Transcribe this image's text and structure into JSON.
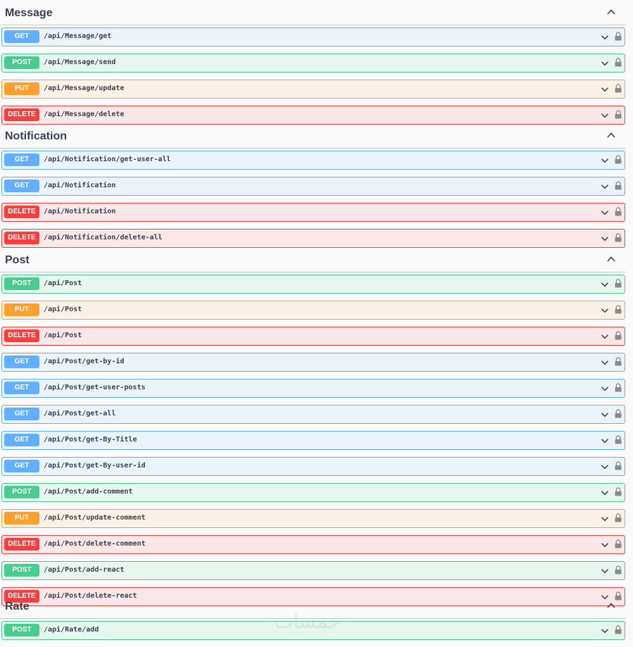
{
  "watermark": "خمسات",
  "sections": [
    {
      "title": "Message",
      "operations": [
        {
          "method": "GET",
          "kind": "get",
          "path": "/api/Message/get"
        },
        {
          "method": "POST",
          "kind": "post",
          "path": "/api/Message/send"
        },
        {
          "method": "PUT",
          "kind": "put",
          "path": "/api/Message/update"
        },
        {
          "method": "DELETE",
          "kind": "delete",
          "path": "/api/Message/delete"
        }
      ]
    },
    {
      "title": "Notification",
      "operations": [
        {
          "method": "GET",
          "kind": "get",
          "path": "/api/Notification/get-user-all"
        },
        {
          "method": "GET",
          "kind": "get",
          "path": "/api/Notification"
        },
        {
          "method": "DELETE",
          "kind": "delete",
          "path": "/api/Notification"
        },
        {
          "method": "DELETE",
          "kind": "delete",
          "path": "/api/Notification/delete-all"
        }
      ]
    },
    {
      "title": "Post",
      "operations": [
        {
          "method": "POST",
          "kind": "post",
          "path": "/api/Post"
        },
        {
          "method": "PUT",
          "kind": "put",
          "path": "/api/Post"
        },
        {
          "method": "DELETE",
          "kind": "delete",
          "path": "/api/Post"
        },
        {
          "method": "GET",
          "kind": "get",
          "path": "/api/Post/get-by-id"
        },
        {
          "method": "GET",
          "kind": "get",
          "path": "/api/Post/get-user-posts"
        },
        {
          "method": "GET",
          "kind": "get",
          "path": "/api/Post/get-all"
        },
        {
          "method": "GET",
          "kind": "get",
          "path": "/api/Post/get-By-Title"
        },
        {
          "method": "GET",
          "kind": "get",
          "path": "/api/Post/get-By-user-id"
        },
        {
          "method": "POST",
          "kind": "post",
          "path": "/api/Post/add-comment"
        },
        {
          "method": "PUT",
          "kind": "put",
          "path": "/api/Post/update-comment"
        },
        {
          "method": "DELETE",
          "kind": "delete",
          "path": "/api/Post/delete-comment"
        },
        {
          "method": "POST",
          "kind": "post",
          "path": "/api/Post/add-react"
        },
        {
          "method": "DELETE",
          "kind": "delete",
          "path": "/api/Post/delete-react"
        }
      ]
    },
    {
      "title": "Rate",
      "operations": [
        {
          "method": "POST",
          "kind": "post",
          "path": "/api/Rate/add"
        }
      ]
    }
  ],
  "icons": {
    "section_toggle": "chevron-up-icon",
    "operation_toggle": "chevron-down-icon",
    "auth": "lock-icon"
  },
  "colors": {
    "get": "#61affe",
    "post": "#49cc90",
    "put": "#fca130",
    "delete": "#f93e3e"
  }
}
